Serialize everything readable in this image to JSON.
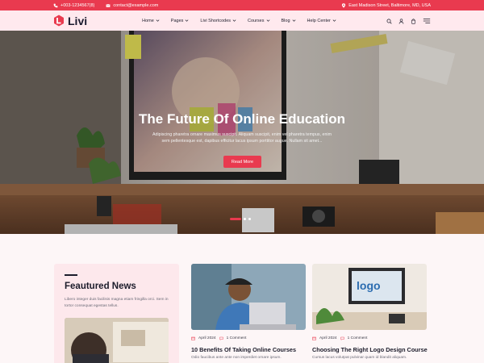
{
  "topbar": {
    "phone": "+003-1234567(8)",
    "email": "contact@example.com",
    "address": "East Madison Street, Baltimore, MD, USA"
  },
  "brand": {
    "name": "Livi"
  },
  "nav": {
    "items": [
      {
        "label": "Home"
      },
      {
        "label": "Pages"
      },
      {
        "label": "Livi Shortcodes"
      },
      {
        "label": "Courses"
      },
      {
        "label": "Blog"
      },
      {
        "label": "Help Center"
      }
    ]
  },
  "icons": {
    "phone": "phone-icon",
    "email": "envelope-icon",
    "address": "map-pin-icon",
    "search": "search-icon",
    "user": "user-icon",
    "cart": "cart-icon",
    "menu": "hamburger-menu-icon",
    "date": "calendar-icon",
    "comments": "comment-icon"
  },
  "hero": {
    "title": "The Future Of Online Education",
    "description": "Adipiscing pharetra ornare maximus suscipit. Aliquam suscipit, enim vel pharetra tempus, enim sem pellentesque est, dapibus efficitur lacus ipsum porttitor augue. Nullam sit amet...",
    "button_label": "Read More",
    "slide_count": 3,
    "active_slide": 1
  },
  "featured": {
    "heading": "Feautured News",
    "text": "Libero integer duis facilisis magna etiam fringilla orci. Sem in tortor consequat egestas tellus."
  },
  "articles": [
    {
      "date": "April 2024",
      "comments": "1 Comment",
      "title": "10 Benefits Of Taking Online Courses",
      "excerpt": "Odio faucibus ante ante non imperdiet ornare ipsum."
    },
    {
      "date": "April 2024",
      "comments": "1 Comment",
      "title": "Choosing The Right Logo Design Course",
      "excerpt": "Cursus lacus volutpat pulvinar quam id blandit aliquam."
    }
  ],
  "colors": {
    "accent": "#e93a4f",
    "header_bg": "#ffe9ee",
    "card_bg": "#fde8ec",
    "dark_text": "#1c1c2b"
  }
}
